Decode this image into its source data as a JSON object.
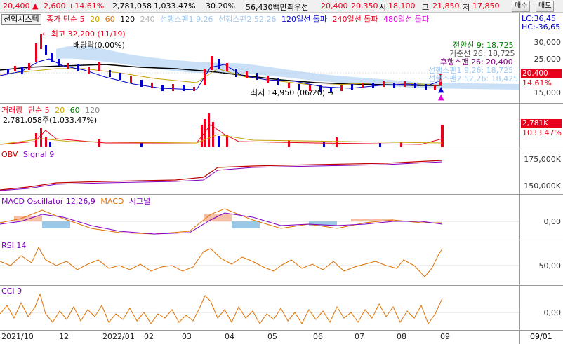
{
  "quote": {
    "price": "20,400",
    "change": "2,600",
    "change_pct": "+14.61%",
    "volume": "2,781,058",
    "volume_ratio": "1,033.47%",
    "turnover": "30.20%",
    "amount": "56,430백만",
    "best_ask_label": "최우선",
    "best_ask": "20,400",
    "best_bid": "20,350",
    "open_label": "시",
    "open": "18,100",
    "high_label": "고",
    "high": "21,850",
    "low_label": "저",
    "low": "17,850",
    "buy_label": "매수",
    "sell_label": "매도"
  },
  "price_panel": {
    "system_label": "선익시스템",
    "legend": [
      {
        "text": "종가 단순 5",
        "color": "#e8001c"
      },
      {
        "text": "20",
        "color": "#c8a000"
      },
      {
        "text": "60",
        "color": "#e07000"
      },
      {
        "text": "120",
        "color": "#000000"
      },
      {
        "text": "240",
        "color": "#b0b0b0"
      },
      {
        "text": "선행스팬1 9,26",
        "color": "#a0c8f0"
      },
      {
        "text": "선행스팬2 52,26",
        "color": "#a0c8f0"
      },
      {
        "text": "120일선 돌파",
        "color": "#0000c8"
      },
      {
        "text": "240일선 돌파",
        "color": "#e8001c"
      },
      {
        "text": "480일선 돌파",
        "color": "#e000e0"
      }
    ],
    "high_marker": "최고 32,200 (11/19)",
    "low_marker": "최저 14,950 (06/20)",
    "dividend_label": "배당락(0.00%)",
    "ichimoku": [
      {
        "text": "전환선 9: 18,725",
        "color": "#008000"
      },
      {
        "text": "기준선 26: 18,725",
        "color": "#555555"
      },
      {
        "text": "후행스팬 26: 20,400",
        "color": "#800080"
      },
      {
        "text": "선행스팬1 9,26: 18,725",
        "color": "#a0c8f0"
      },
      {
        "text": "선행스팬2 52,26: 18,425",
        "color": "#a0c8f0"
      }
    ],
    "scale_top": "LC:36,45",
    "scale_top2": "HC:-36,65",
    "ticks": [
      "30,000",
      "25,000",
      "15,000"
    ],
    "price_tag": "20,400",
    "pct_tag": "14.61%"
  },
  "volume_panel": {
    "legend": [
      {
        "text": "거래량",
        "color": "#e8001c"
      },
      {
        "text": "단순 5",
        "color": "#e8001c"
      },
      {
        "text": "20",
        "color": "#c8a000"
      },
      {
        "text": "60",
        "color": "#008000"
      },
      {
        "text": "120",
        "color": "#808080"
      }
    ],
    "info": "2,781,058주(1,033.47%)",
    "tag": "2,781K",
    "tag2": "1033.47%"
  },
  "obv_panel": {
    "legend": [
      {
        "text": "OBV",
        "color": "#c00000"
      },
      {
        "text": "Signal 9",
        "color": "#8000c0"
      }
    ],
    "ticks": [
      "175,000K",
      "150,000K"
    ]
  },
  "macd_panel": {
    "legend": [
      {
        "text": "MACD Oscillator 12,26,9",
        "color": "#8000c0"
      },
      {
        "text": "MACD",
        "color": "#e07000"
      },
      {
        "text": "시그널",
        "color": "#8000c0"
      }
    ],
    "ticks": [
      "0,00"
    ]
  },
  "rsi_panel": {
    "legend": [
      {
        "text": "RSI 14",
        "color": "#8000c0"
      }
    ],
    "ticks": [
      "50,00"
    ]
  },
  "cci_panel": {
    "legend": [
      {
        "text": "CCI 9",
        "color": "#8000c0"
      }
    ],
    "ticks": [
      "0,00"
    ]
  },
  "x_axis": [
    "2021/10",
    "12",
    "2022/01",
    "02",
    "03",
    "04",
    "05",
    "06",
    "07",
    "08",
    "09"
  ],
  "x_axis_right": "09/01"
}
